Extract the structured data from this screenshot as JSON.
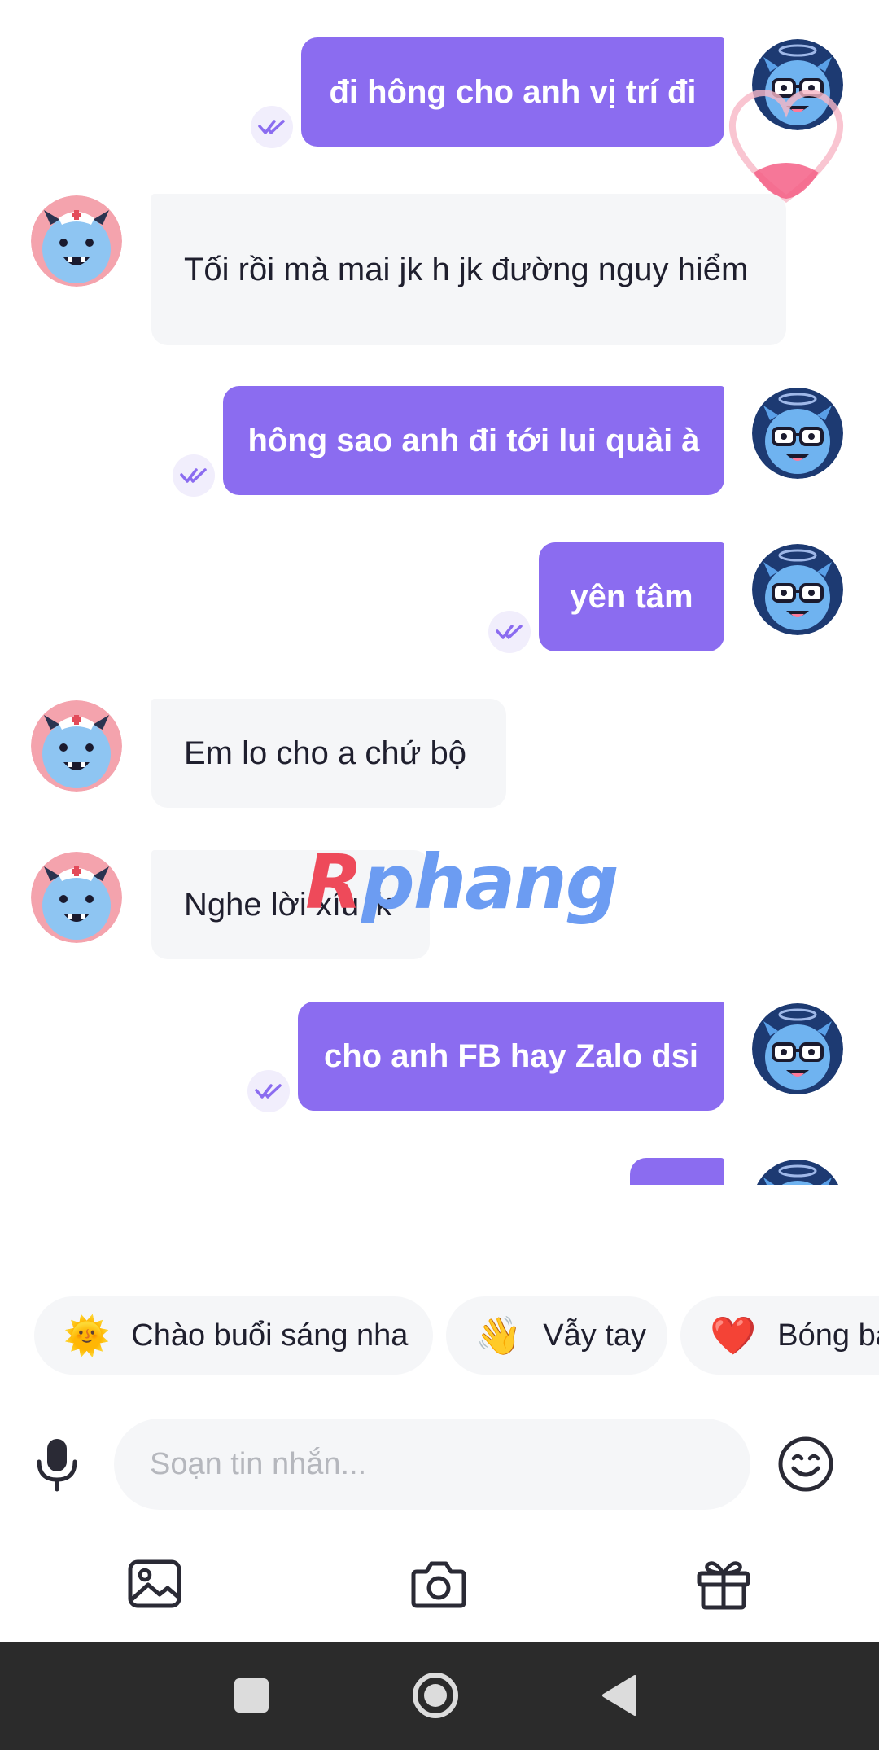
{
  "messages": [
    {
      "side": "out",
      "text": "đi hông cho anh vị trí đi"
    },
    {
      "side": "in",
      "text": "Tối rồi mà mai jk h jk đường nguy hiểm"
    },
    {
      "side": "out",
      "text": "hông sao anh đi tới lui quài à"
    },
    {
      "side": "out",
      "text": "yên tâm"
    },
    {
      "side": "in",
      "text": "Em lo cho a chứ bộ"
    },
    {
      "side": "in",
      "text": "Nghe lời xíu jk"
    },
    {
      "side": "out",
      "text": "cho anh FB hay Zalo dsi"
    }
  ],
  "watermark": {
    "first": "R",
    "rest": "phang"
  },
  "suggestions": [
    {
      "icon": "sun-emoji-icon",
      "emoji": "🌞",
      "label": "Chào buổi sáng nha"
    },
    {
      "icon": "waving-hand-icon",
      "emoji": "👋",
      "label": "Vẫy tay"
    },
    {
      "icon": "heart-icon",
      "emoji": "❤️",
      "label": "Bóng ba"
    }
  ],
  "composer": {
    "placeholder": "Soạn tin nhắn..."
  },
  "toolbar": [
    "gallery-icon",
    "camera-icon",
    "gift-icon"
  ],
  "colors": {
    "outgoing_bubble": "#8b6cf0",
    "incoming_bubble": "#f5f6f8",
    "nav_bar": "#2b2b2b"
  }
}
